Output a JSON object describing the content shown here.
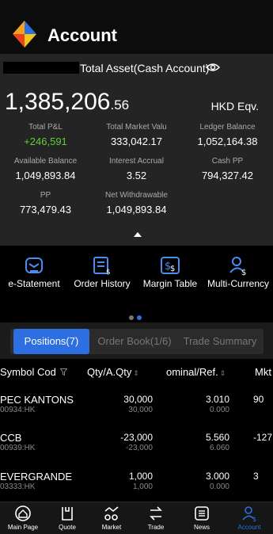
{
  "header": {
    "title": "Account"
  },
  "summary": {
    "account_label": "Total Asset(Cash Account)",
    "total_int": "1,385,206",
    "total_dec": ".56",
    "currency": "HKD Eqv.",
    "metrics": [
      {
        "label": "Total P&L",
        "value": "+246,591"
      },
      {
        "label": "Total Market Valu",
        "value": "333,042.17"
      },
      {
        "label": "Ledger Balance",
        "value": "1,052,164.38"
      },
      {
        "label": "Available Balance",
        "value": "1,049,893.84"
      },
      {
        "label": "Interest Accrual",
        "value": "3.52"
      },
      {
        "label": "Cash PP",
        "value": "794,327.42"
      },
      {
        "label": "PP",
        "value": "773,479.43"
      },
      {
        "label": "Net Withdrawable",
        "value": "1,049,893.84"
      }
    ],
    "pl_color": "#5ecf3a"
  },
  "quick_actions": [
    {
      "label": "e-Statement",
      "icon": "statement-icon"
    },
    {
      "label": "Order History",
      "icon": "order-history-icon"
    },
    {
      "label": "Margin Table",
      "icon": "margin-table-icon"
    },
    {
      "label": "Multi-Currency",
      "icon": "multi-currency-icon"
    }
  ],
  "tabs": [
    {
      "label": "Positions(7)",
      "active": true
    },
    {
      "label": "Order Book(1/6)",
      "active": false
    },
    {
      "label": "Trade Summary",
      "active": false
    }
  ],
  "table": {
    "headers": [
      "Symbol Cod",
      "Qty/A.Qty",
      "ominal/Ref.",
      "Mkt"
    ],
    "rows": [
      {
        "symbol": "PEC KANTONS",
        "code": "00934:HK",
        "qty": "30,000",
        "aqty": "30,000",
        "nominal": "3.010",
        "ref": "0.000",
        "mkt": "90"
      },
      {
        "symbol": "CCB",
        "code": "00939:HK",
        "qty": "-23,000",
        "aqty": "-23,000",
        "nominal": "5.560",
        "ref": "6.060",
        "mkt": "-127"
      },
      {
        "symbol": "EVERGRANDE",
        "code": "03333:HK",
        "qty": "1,000",
        "aqty": "1,000",
        "nominal": "3.000",
        "ref": "0.000",
        "mkt": "3"
      }
    ]
  },
  "bottom_nav": [
    {
      "label": "Main Page",
      "icon": "home-icon"
    },
    {
      "label": "Quote",
      "icon": "quote-icon"
    },
    {
      "label": "Market",
      "icon": "market-icon"
    },
    {
      "label": "Trade",
      "icon": "trade-icon"
    },
    {
      "label": "News",
      "icon": "news-icon"
    },
    {
      "label": "Account",
      "icon": "account-icon",
      "active": true
    }
  ],
  "accent_color": "#2d6fe0"
}
